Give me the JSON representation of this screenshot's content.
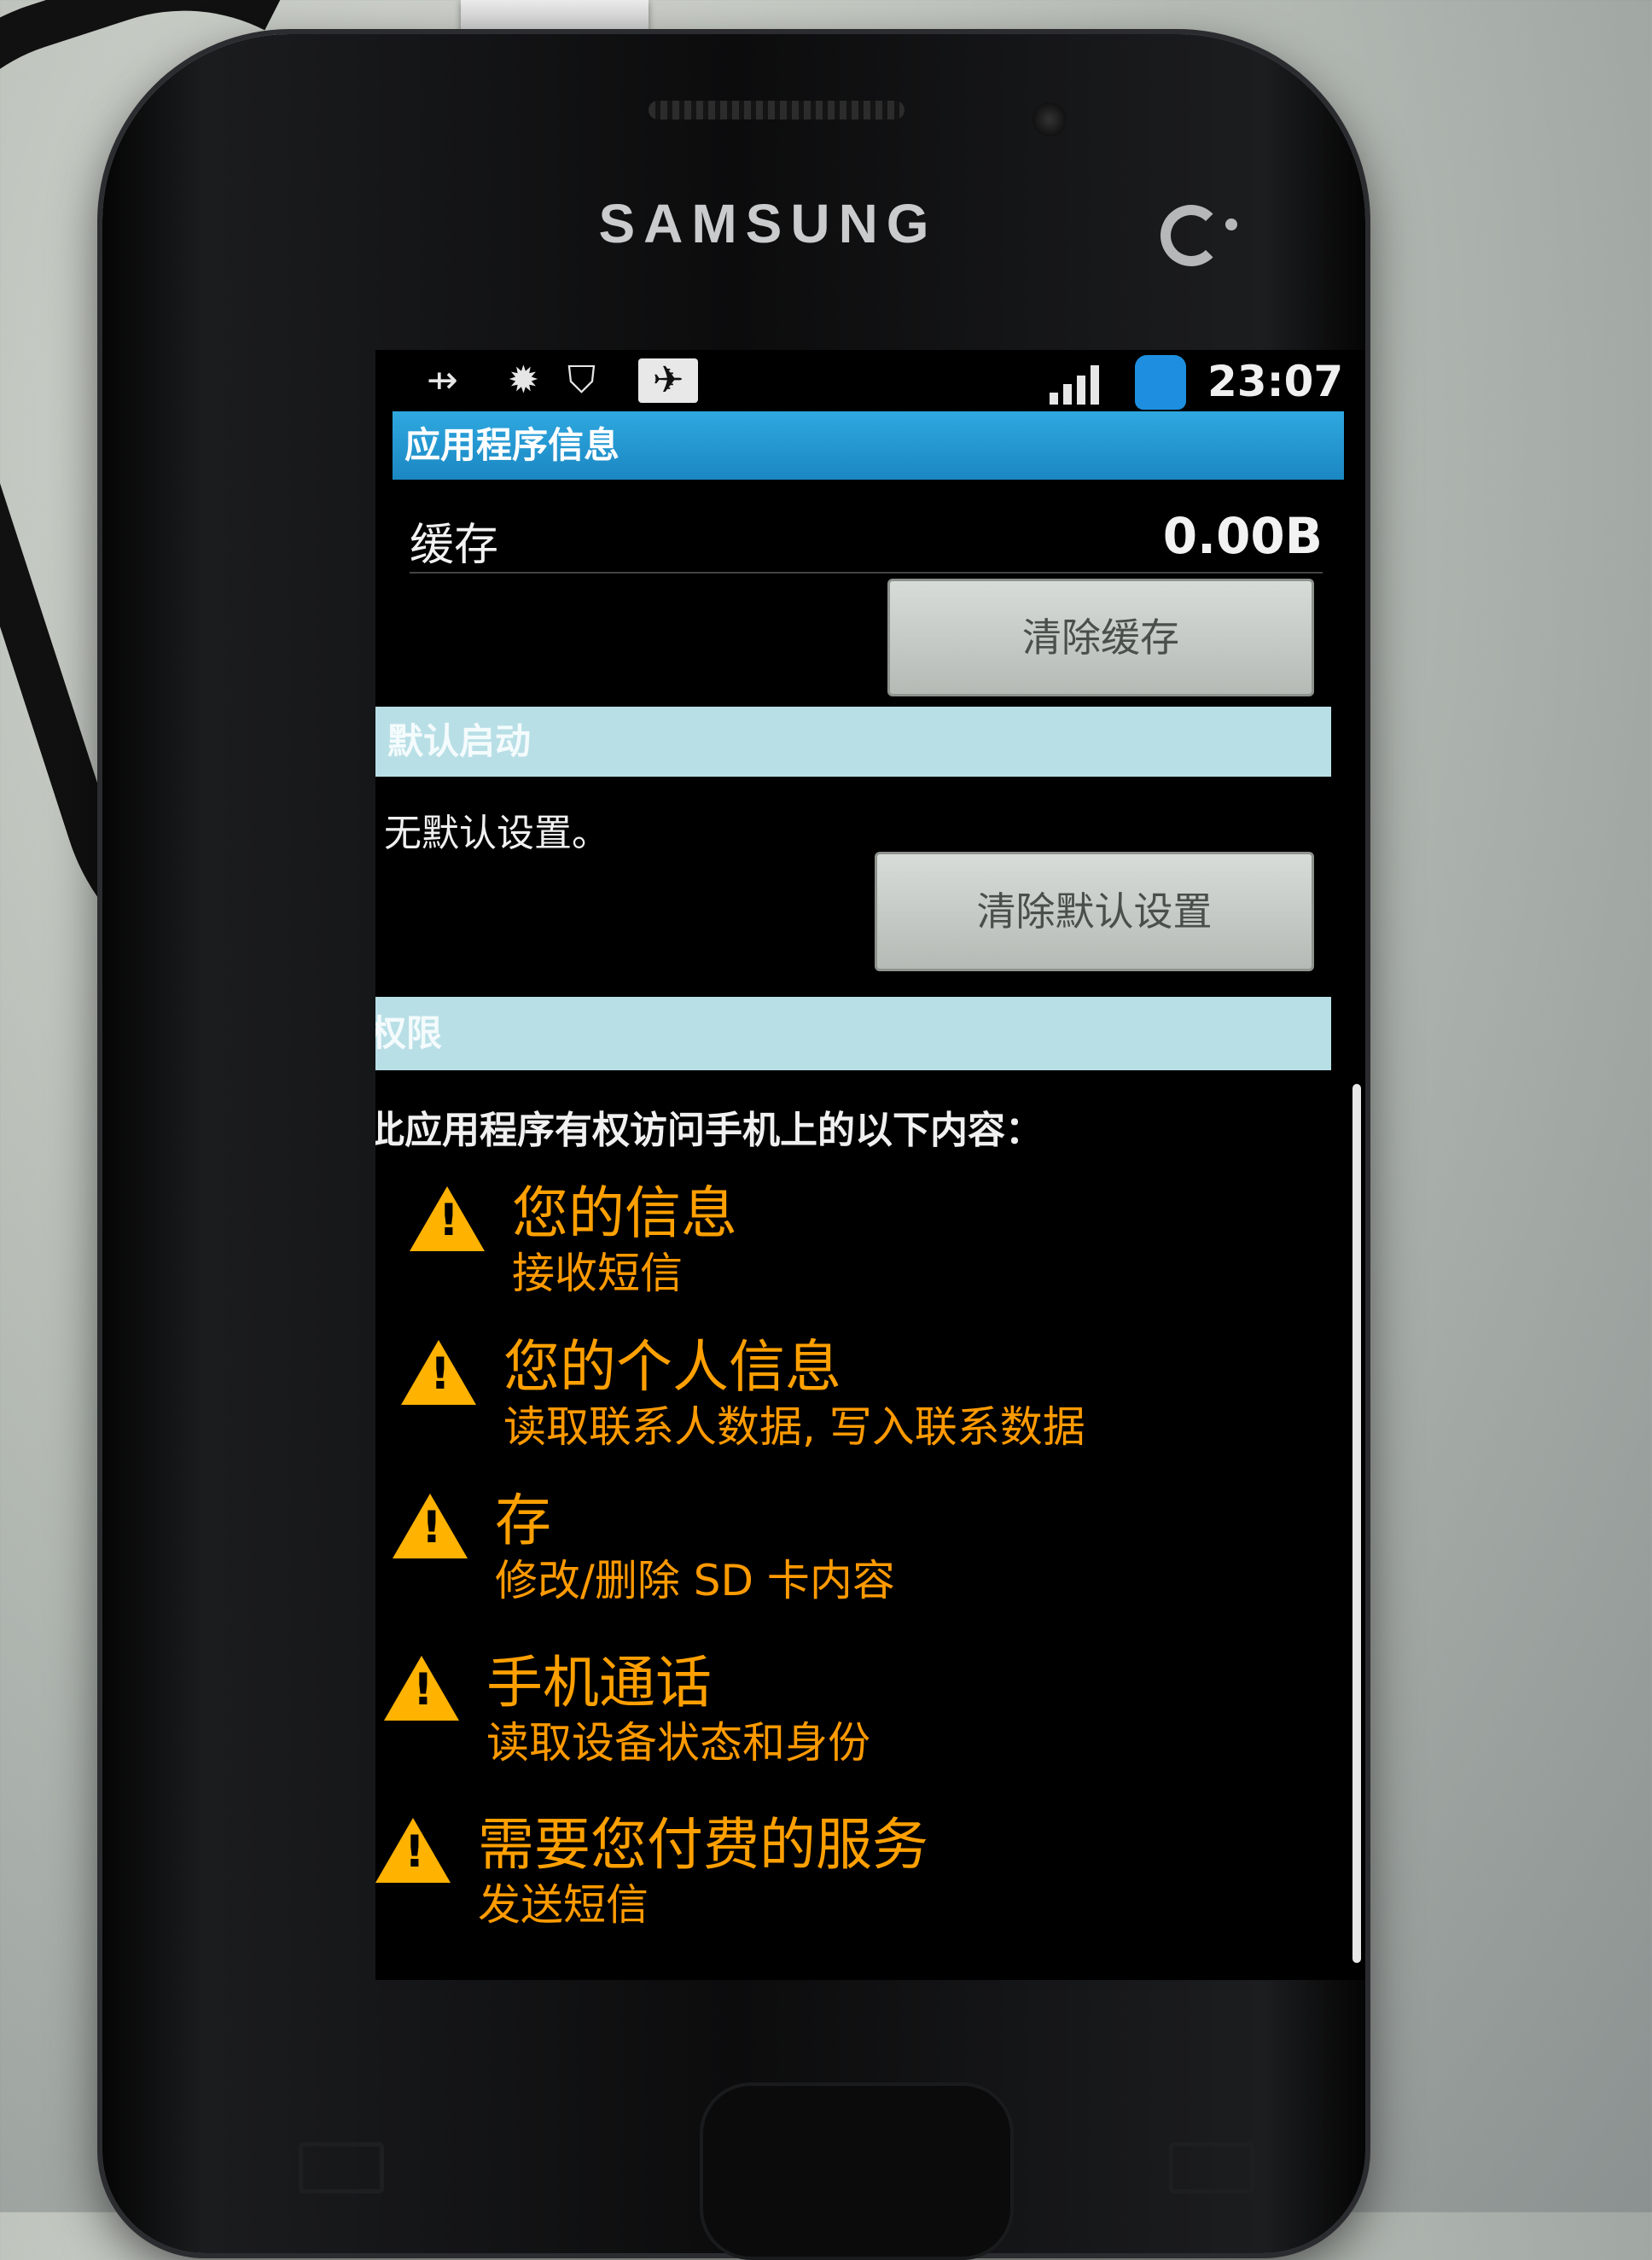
{
  "device": {
    "brand": "SAMSUNG"
  },
  "status_bar": {
    "time": "23:07",
    "icons": [
      "usb-icon",
      "bug-icon",
      "shield-icon",
      "notification-icon",
      "signal-icon",
      "battery-icon"
    ]
  },
  "title": "应用程序信息",
  "cache": {
    "label": "缓存",
    "value": "0.00B",
    "clear_button": "清除缓存"
  },
  "default_launch": {
    "header": "默认启动",
    "text": "无默认设置。",
    "clear_button": "清除默认设置"
  },
  "permissions": {
    "header": "权限",
    "intro": "此应用程序有权访问手机上的以下内容：",
    "items": [
      {
        "title": "您的信息",
        "detail": "接收短信"
      },
      {
        "title": "您的个人信息",
        "detail": "读取联系人数据, 写入联系数据"
      },
      {
        "title": "存",
        "detail": "修改/删除 SD 卡内容"
      },
      {
        "title": "手机通话",
        "detail": "读取设备状态和身份"
      },
      {
        "title": "需要您付费的服务",
        "detail": "发送短信"
      }
    ]
  },
  "colors": {
    "title_bar": "#2fa8e0",
    "section_header": "#b9dfe6",
    "warning": "#ffa000"
  }
}
